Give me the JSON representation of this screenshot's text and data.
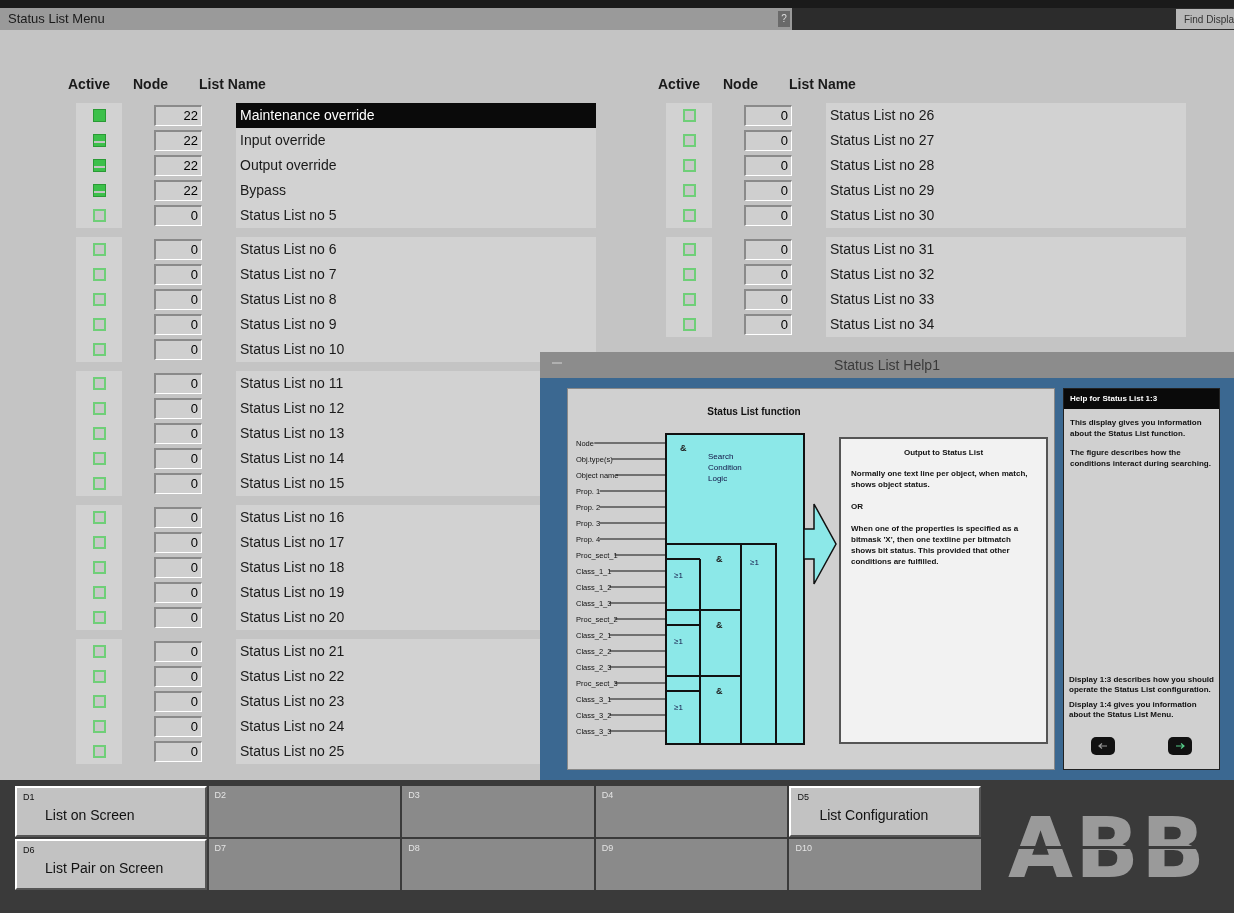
{
  "window": {
    "title": "Status List Menu",
    "help_button": "?",
    "find_button": "Find Displa"
  },
  "left_table": {
    "columns": [
      "Active",
      "Node",
      "List Name"
    ],
    "rows": [
      {
        "checked": true,
        "partial": false,
        "node": "22",
        "name": "Maintenance override",
        "selected": true
      },
      {
        "checked": true,
        "partial": true,
        "node": "22",
        "name": "Input override",
        "selected": false
      },
      {
        "checked": true,
        "partial": true,
        "node": "22",
        "name": "Output override",
        "selected": false
      },
      {
        "checked": true,
        "partial": true,
        "node": "22",
        "name": "Bypass",
        "selected": false
      },
      {
        "checked": false,
        "node": "0",
        "name": "Status List no 5",
        "selected": false
      },
      {
        "checked": false,
        "node": "0",
        "name": "Status List no 6",
        "selected": false
      },
      {
        "checked": false,
        "node": "0",
        "name": "Status List no 7",
        "selected": false
      },
      {
        "checked": false,
        "node": "0",
        "name": "Status List no 8",
        "selected": false
      },
      {
        "checked": false,
        "node": "0",
        "name": "Status List no 9",
        "selected": false
      },
      {
        "checked": false,
        "node": "0",
        "name": "Status List no 10",
        "selected": false
      },
      {
        "checked": false,
        "node": "0",
        "name": "Status List no 11",
        "selected": false
      },
      {
        "checked": false,
        "node": "0",
        "name": "Status List no 12",
        "selected": false
      },
      {
        "checked": false,
        "node": "0",
        "name": "Status List no 13",
        "selected": false
      },
      {
        "checked": false,
        "node": "0",
        "name": "Status List no 14",
        "selected": false
      },
      {
        "checked": false,
        "node": "0",
        "name": "Status List no 15",
        "selected": false
      },
      {
        "checked": false,
        "node": "0",
        "name": "Status List no 16",
        "selected": false
      },
      {
        "checked": false,
        "node": "0",
        "name": "Status List no 17",
        "selected": false
      },
      {
        "checked": false,
        "node": "0",
        "name": "Status List no 18",
        "selected": false
      },
      {
        "checked": false,
        "node": "0",
        "name": "Status List no 19",
        "selected": false
      },
      {
        "checked": false,
        "node": "0",
        "name": "Status List no 20",
        "selected": false
      },
      {
        "checked": false,
        "node": "0",
        "name": "Status List no 21",
        "selected": false
      },
      {
        "checked": false,
        "node": "0",
        "name": "Status List no 22",
        "selected": false
      },
      {
        "checked": false,
        "node": "0",
        "name": "Status List no 23",
        "selected": false
      },
      {
        "checked": false,
        "node": "0",
        "name": "Status List no 24",
        "selected": false
      },
      {
        "checked": false,
        "node": "0",
        "name": "Status List no 25",
        "selected": false
      }
    ]
  },
  "right_table": {
    "columns": [
      "Active",
      "Node",
      "List Name"
    ],
    "rows": [
      {
        "checked": false,
        "node": "0",
        "name": "Status List no 26",
        "selected": false
      },
      {
        "checked": false,
        "node": "0",
        "name": "Status List no 27",
        "selected": false
      },
      {
        "checked": false,
        "node": "0",
        "name": "Status List no 28",
        "selected": false
      },
      {
        "checked": false,
        "node": "0",
        "name": "Status List no 29",
        "selected": false
      },
      {
        "checked": false,
        "node": "0",
        "name": "Status List no 30",
        "selected": false
      },
      {
        "checked": false,
        "node": "0",
        "name": "Status List no 31",
        "selected": false
      },
      {
        "checked": false,
        "node": "0",
        "name": "Status List no 32",
        "selected": false
      },
      {
        "checked": false,
        "node": "0",
        "name": "Status List no 33",
        "selected": false
      },
      {
        "checked": false,
        "node": "0",
        "name": "Status List no 34",
        "selected": false
      }
    ]
  },
  "help_window": {
    "title": "Status List Help1",
    "diagram": {
      "title": "Status List function",
      "inputs": [
        "Node",
        "Obj.type(s)",
        "Object name",
        "Prop. 1",
        "Prop. 2",
        "Prop. 3",
        "Prop. 4",
        "Proc_sect_1",
        "Class_1_1",
        "Class_1_2",
        "Class_1_3",
        "Proc_sect_2",
        "Class_2_1",
        "Class_2_2",
        "Class_2_3",
        "Proc_sect_3",
        "Class_3_1",
        "Class_3_2",
        "Class_3_3"
      ],
      "main_symbol": "&",
      "logic_label": "Search Condition Logic",
      "or_symbol": "≥1",
      "groups": [
        {
          "and_symbol": "&",
          "or_symbol": "≥1"
        },
        {
          "and_symbol": "&",
          "or_symbol": "≥1"
        },
        {
          "and_symbol": "&",
          "or_symbol": "≥1"
        }
      ],
      "output_title": "Output to Status List",
      "output_paragraphs": [
        "Normally one text line per object, when match, shows object status.",
        "OR",
        "When one of the properties is specified as a bitmask 'X', then one textline per bitmatch shows bit status. This provided that other conditions are fulfilled."
      ]
    },
    "side_title": "Help for Status List 1:3",
    "side_paragraphs": [
      "This display gives you information about the Status List function.",
      "The figure describes how the conditions interact during searching."
    ],
    "side_notes": [
      "Display 1:3 describes how you should operate the Status List configuration.",
      "Display 1:4 gives you information about the Status List Menu."
    ]
  },
  "function_keys": [
    {
      "key": "D1",
      "label": "List on Screen",
      "disabled": false
    },
    {
      "key": "D2",
      "disabled": true
    },
    {
      "key": "D3",
      "disabled": true
    },
    {
      "key": "D4",
      "disabled": true
    },
    {
      "key": "D5",
      "label": "List Configuration",
      "disabled": false
    },
    {
      "key": "D6",
      "label": "List Pair on Screen",
      "disabled": false
    },
    {
      "key": "D7",
      "disabled": true
    },
    {
      "key": "D8",
      "disabled": true
    },
    {
      "key": "D9",
      "disabled": true
    },
    {
      "key": "D10",
      "disabled": true
    }
  ],
  "logo": "ABB"
}
